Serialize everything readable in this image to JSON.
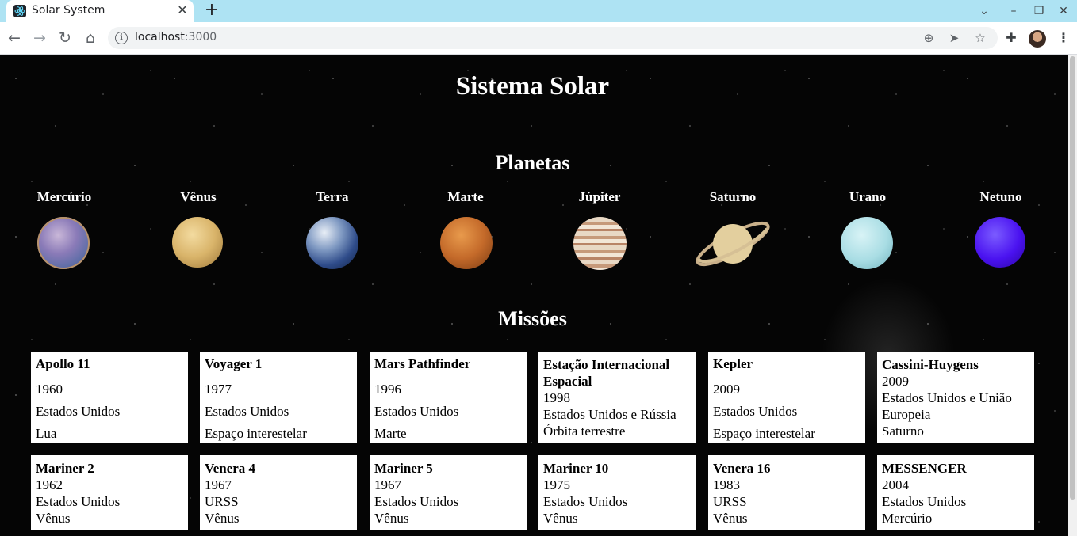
{
  "browser": {
    "tab_title": "Solar System",
    "url_host": "localhost",
    "url_port": ":3000"
  },
  "page": {
    "title": "Sistema Solar",
    "planets_heading": "Planetas",
    "missions_heading": "Missões"
  },
  "planets": [
    {
      "name": "Mercúrio"
    },
    {
      "name": "Vênus"
    },
    {
      "name": "Terra"
    },
    {
      "name": "Marte"
    },
    {
      "name": "Júpiter"
    },
    {
      "name": "Saturno"
    },
    {
      "name": "Urano"
    },
    {
      "name": "Netuno"
    }
  ],
  "missions": [
    {
      "name": "Apollo 11",
      "year": "1960",
      "country": "Estados Unidos",
      "destination": "Lua"
    },
    {
      "name": "Voyager 1",
      "year": "1977",
      "country": "Estados Unidos",
      "destination": "Espaço interestelar"
    },
    {
      "name": "Mars Pathfinder",
      "year": "1996",
      "country": "Estados Unidos",
      "destination": "Marte"
    },
    {
      "name": "Estação Internacional Espacial",
      "year": "1998",
      "country": "Estados Unidos e Rússia",
      "destination": "Órbita terrestre"
    },
    {
      "name": "Kepler",
      "year": "2009",
      "country": "Estados Unidos",
      "destination": "Espaço interestelar"
    },
    {
      "name": "Cassini-Huygens",
      "year": "2009",
      "country": "Estados Unidos e União Europeia",
      "destination": "Saturno"
    },
    {
      "name": "Mariner 2",
      "year": "1962",
      "country": "Estados Unidos",
      "destination": "Vênus"
    },
    {
      "name": "Venera 4",
      "year": "1967",
      "country": "URSS",
      "destination": "Vênus"
    },
    {
      "name": "Mariner 5",
      "year": "1967",
      "country": "Estados Unidos",
      "destination": "Vênus"
    },
    {
      "name": "Mariner 10",
      "year": "1975",
      "country": "Estados Unidos",
      "destination": "Vênus"
    },
    {
      "name": "Venera 16",
      "year": "1983",
      "country": "URSS",
      "destination": "Vênus"
    },
    {
      "name": "MESSENGER",
      "year": "2004",
      "country": "Estados Unidos",
      "destination": "Mercúrio"
    }
  ],
  "icons": {
    "back": "arrow-left-icon",
    "forward": "arrow-right-icon",
    "reload": "reload-icon",
    "home": "home-icon",
    "zoom": "zoom-icon",
    "send": "send-icon",
    "bookmark": "star-icon",
    "extensions": "puzzle-icon",
    "menu": "kebab-menu-icon"
  }
}
